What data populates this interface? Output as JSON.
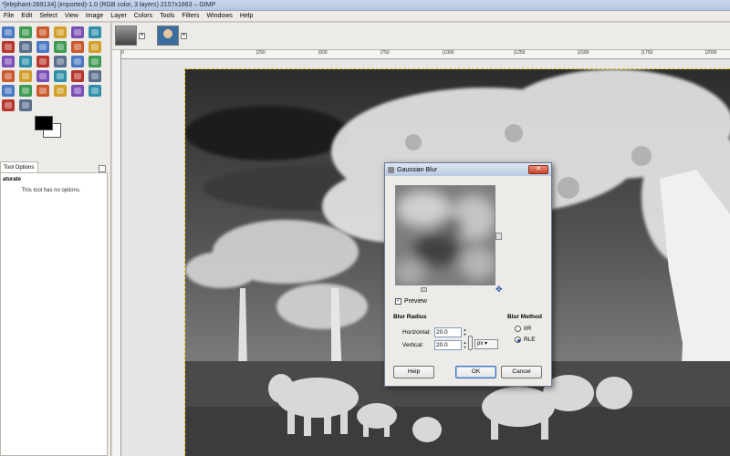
{
  "window": {
    "title": "*[elephant-289134] (imported)-1.0 (RGB color, 3 layers) 2157x1663 – GIMP"
  },
  "menu": [
    "File",
    "Edit",
    "Select",
    "View",
    "Image",
    "Layer",
    "Colors",
    "Tools",
    "Filters",
    "Windows",
    "Help"
  ],
  "toolbox": {
    "tools": [
      "rect-select",
      "ellipse-select",
      "free-select",
      "fuzzy-select",
      "color-select",
      "scissors-select",
      "foreground-select",
      "paths",
      "color-picker",
      "zoom",
      "measure",
      "move",
      "align",
      "crop",
      "rotate",
      "scale",
      "shear",
      "perspective",
      "flip",
      "cage-transform",
      "text",
      "bucket-fill",
      "blend",
      "pencil",
      "paintbrush",
      "eraser",
      "airbrush",
      "ink",
      "heal",
      "clone",
      "smudge",
      "dodge-burn"
    ],
    "fg_color": "#000000",
    "bg_color": "#ffffff"
  },
  "tool_options": {
    "tab": "Tool Options",
    "tool_name": "aturate",
    "note": "This tool has no options."
  },
  "rulers": {
    "h": [
      "0",
      "|250",
      "|500",
      "|750",
      "|1000",
      "|1250",
      "|1500",
      "|1750",
      "|2000"
    ]
  },
  "dialog": {
    "title": "Gaussian Blur",
    "close": "✕",
    "preview_label": "Preview",
    "preview_checked": true,
    "blur_radius_title": "Blur Radius",
    "horizontal_label": "Horizontal:",
    "horizontal_value": "20.0",
    "vertical_label": "Vertical:",
    "vertical_value": "20.0",
    "unit": "px ▾",
    "blur_method_title": "Blur Method",
    "methods": [
      "IIR",
      "RLE"
    ],
    "selected_method": "RLE",
    "help": "Help",
    "ok": "OK",
    "cancel": "Cancel"
  },
  "colors": {
    "titlebar": "#c9d7ea",
    "accent": "#1b3f99"
  }
}
